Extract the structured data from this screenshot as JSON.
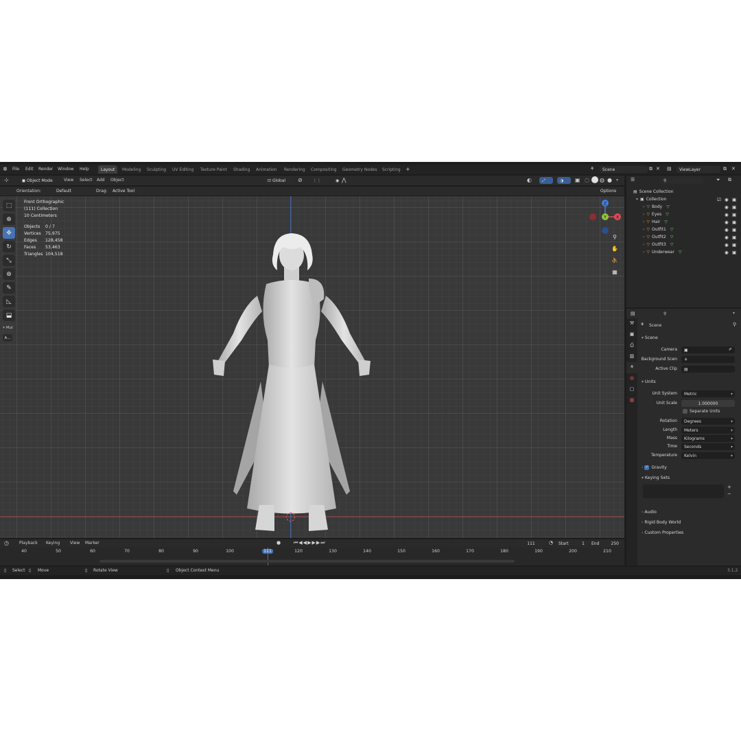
{
  "top_menu": {
    "items": [
      "File",
      "Edit",
      "Render",
      "Window",
      "Help"
    ],
    "workspaces": [
      "Layout",
      "Modeling",
      "Sculpting",
      "UV Editing",
      "Texture Paint",
      "Shading",
      "Animation",
      "Rendering",
      "Compositing",
      "Geometry Nodes",
      "Scripting"
    ],
    "add_tab": "+",
    "scene_name": "Scene",
    "view_layer": "ViewLayer"
  },
  "viewport_header": {
    "mode": "Object Mode",
    "menus": [
      "View",
      "Select",
      "Add",
      "Object"
    ],
    "transform_orientation": "Global"
  },
  "tool_settings": {
    "orientation_label": "Orientation:",
    "orientation_value": "Default",
    "drag_label": "Drag:",
    "drag_value": "Active Tool",
    "options": "Options"
  },
  "viewport_info": {
    "view_name": "Front Orthographic",
    "collection": "(111) Collection",
    "scale": "10 Centimeters",
    "stats": [
      {
        "label": "Objects",
        "value": "0 / 7"
      },
      {
        "label": "Vertices",
        "value": "75,975"
      },
      {
        "label": "Edges",
        "value": "128,458"
      },
      {
        "label": "Faces",
        "value": "53,463"
      },
      {
        "label": "Triangles",
        "value": "104,518"
      }
    ]
  },
  "toolbar": {
    "extra_label": "Mul",
    "extra_button": "A..."
  },
  "gizmo": {
    "x": "X",
    "y": "Y",
    "z": "Z",
    "x_color": "#e04a56",
    "y_color": "#8fc43c",
    "z_color": "#3f7fe0"
  },
  "timeline": {
    "menus": [
      "Playback",
      "Keying",
      "View",
      "Marker"
    ],
    "current_frame": "111",
    "start_label": "Start",
    "start_value": "1",
    "end_label": "End",
    "end_value": "250",
    "ruler": [
      "40",
      "50",
      "60",
      "70",
      "80",
      "90",
      "100",
      "111",
      "120",
      "130",
      "140",
      "150",
      "160",
      "170",
      "180",
      "190",
      "200",
      "210"
    ]
  },
  "status_bar": {
    "select": "Select",
    "move": "Move",
    "rotate": "Rotate View",
    "context": "Object Context Menu",
    "version": "3.1.2"
  },
  "outliner": {
    "scene_collection": "Scene Collection",
    "collection": "Collection",
    "objects": [
      "Body",
      "Eyes",
      "Hair",
      "Outfit1",
      "Outfit2",
      "Outfit3",
      "Underwear"
    ]
  },
  "properties": {
    "context": "Scene",
    "scene_panel": {
      "title": "Scene",
      "camera_label": "Camera",
      "background_label": "Background Scen",
      "active_clip_label": "Active Clip"
    },
    "units_panel": {
      "title": "Units",
      "unit_system_label": "Unit System",
      "unit_system": "Metric",
      "unit_scale_label": "Unit Scale",
      "unit_scale": "1.000000",
      "separate_units": "Separate Units",
      "rotation_label": "Rotation",
      "rotation": "Degrees",
      "length_label": "Length",
      "length": "Meters",
      "mass_label": "Mass",
      "mass": "Kilograms",
      "time_label": "Time",
      "time": "Seconds",
      "temperature_label": "Temperature",
      "temperature": "Kelvin"
    },
    "gravity": "Gravity",
    "keying_sets": "Keying Sets",
    "audio": "Audio",
    "rigid_body_world": "Rigid Body World",
    "custom_properties": "Custom Properties"
  },
  "colors": {
    "accent": "#4772b3",
    "object_icon": "#e8913a",
    "mesh_icon": "#6fd46f"
  }
}
